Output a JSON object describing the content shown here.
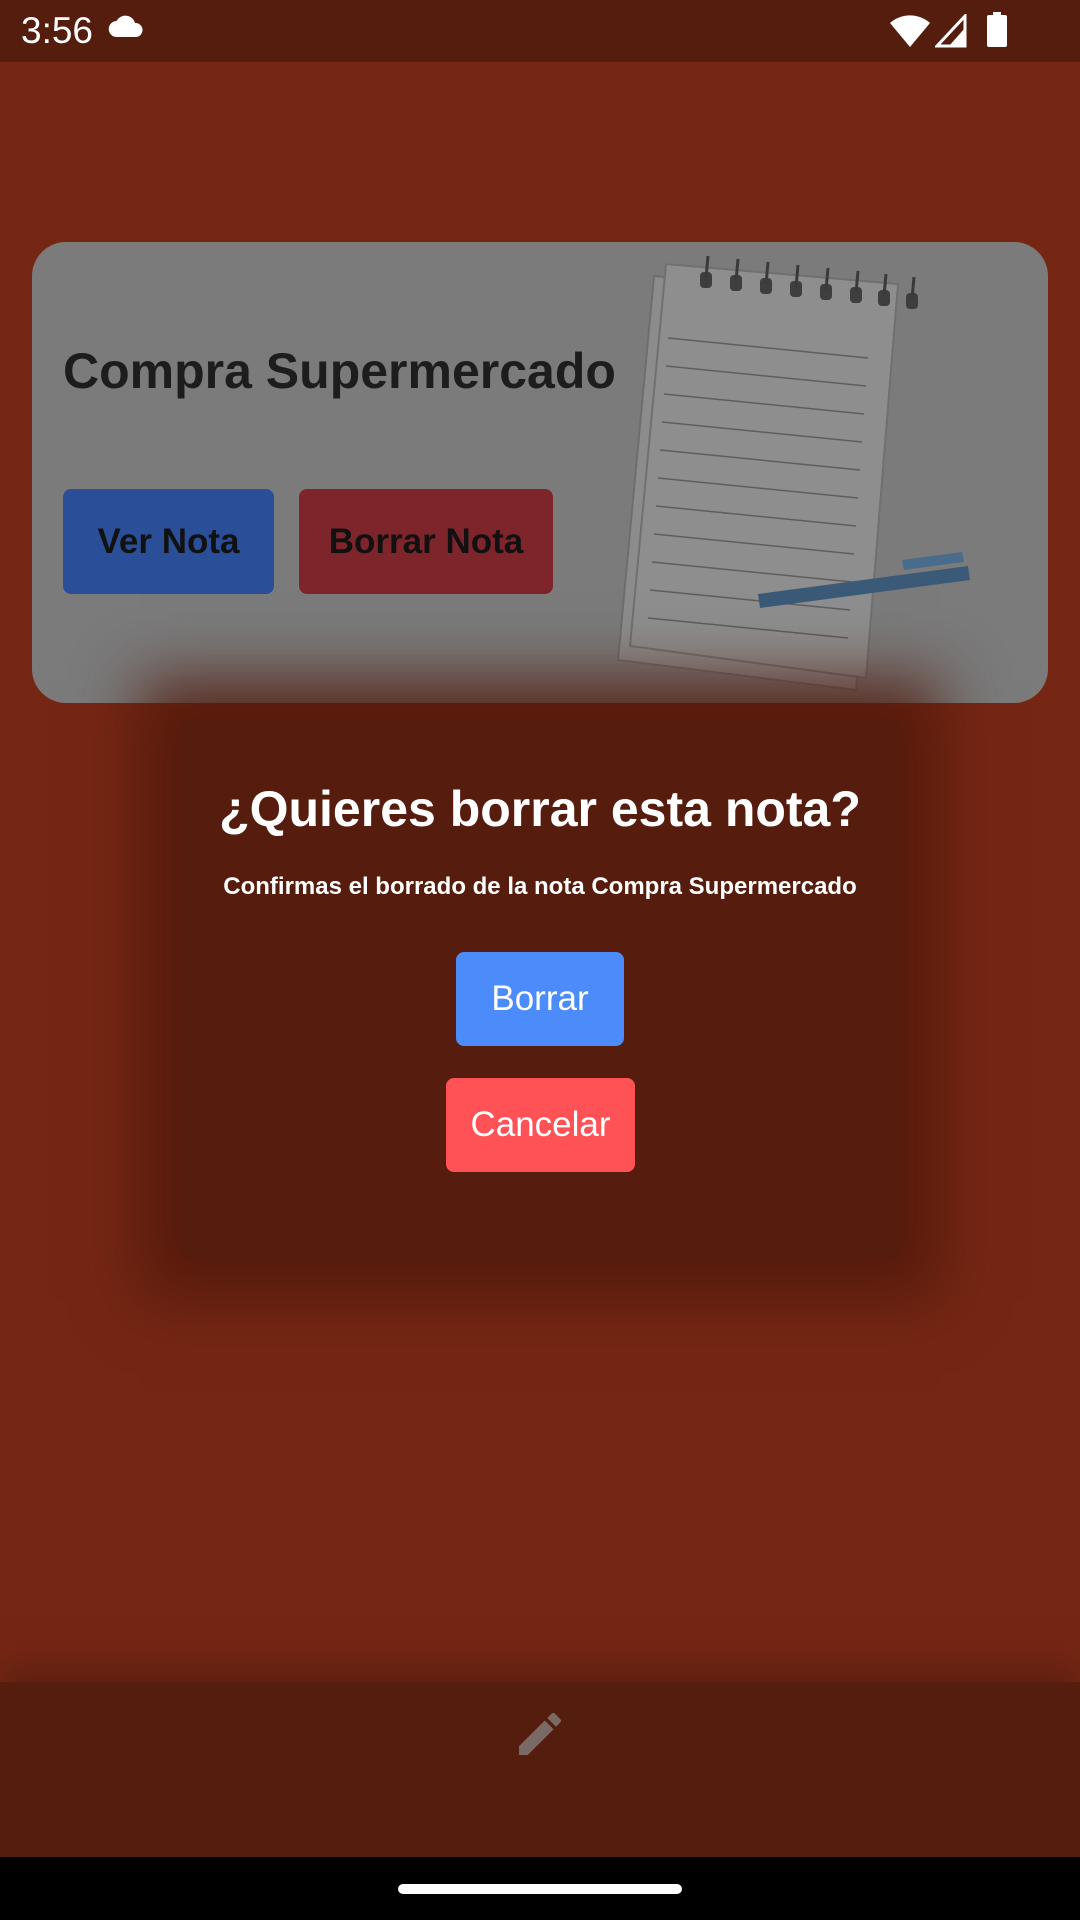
{
  "status_bar": {
    "time": "3:56",
    "icons": [
      "cloud-icon",
      "wifi-icon",
      "signal-icon",
      "battery-icon"
    ]
  },
  "note_card": {
    "title": "Compra Supermercado",
    "view_button": "Ver Nota",
    "delete_button": "Borrar Nota",
    "illustration": "notebook-with-pen"
  },
  "dialog": {
    "title": "¿Quieres borrar esta nota?",
    "message": "Confirmas el borrado de la nota Compra Supermercado",
    "confirm_button": "Borrar",
    "cancel_button": "Cancelar"
  },
  "bottom_bar": {
    "icon": "edit-icon"
  },
  "colors": {
    "background": "#762714",
    "dialog": "#561d0e",
    "confirm": "#4c8bfa",
    "cancel": "#ff5257",
    "view_button": "#2a4f98",
    "delete_button": "#7d252b"
  }
}
